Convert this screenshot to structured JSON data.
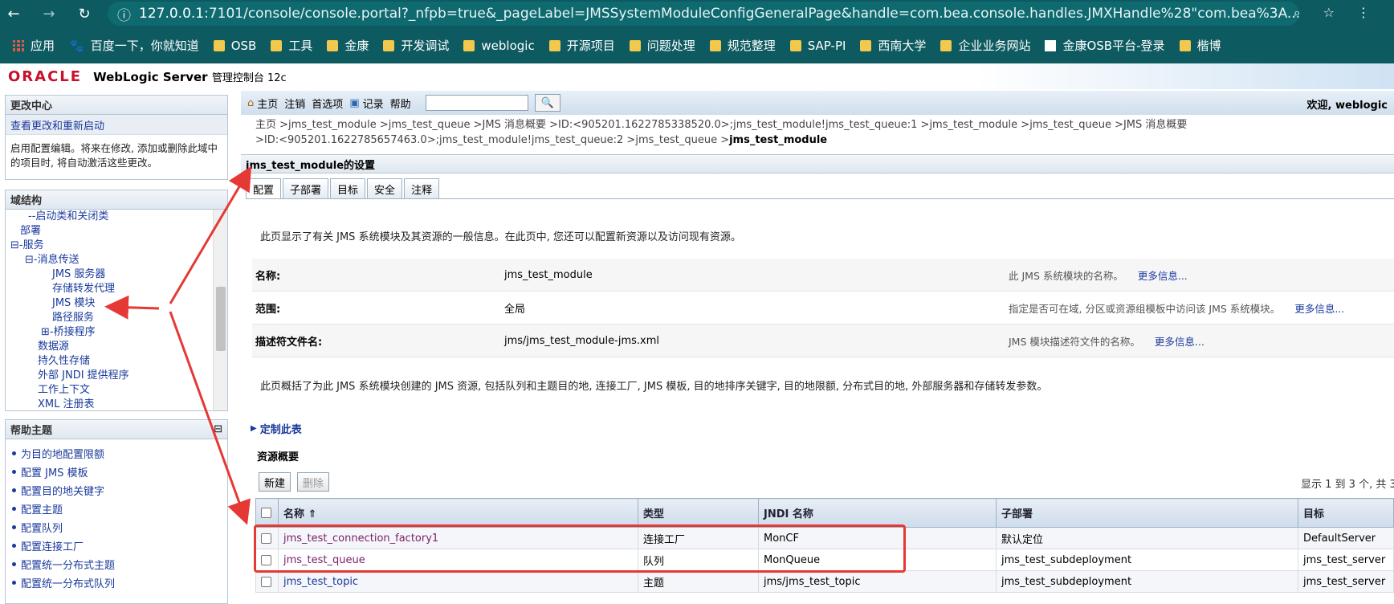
{
  "browser": {
    "url_host": "127.0.0.1",
    "url_rest": ":7101/console/console.portal?_nfpb=true&_pageLabel=JMSSystemModuleConfigGeneralPage&handle=com.bea.console.handles.JMXHandle%28\"com.bea%3A...",
    "bookmarks": [
      "应用",
      "百度一下，你就知道",
      "OSB",
      "工具",
      "金康",
      "开发调试",
      "weblogic",
      "开源项目",
      "问题处理",
      "规范整理",
      "SAP-PI",
      "西南大学",
      "企业业务网站",
      "金康OSB平台-登录",
      "楷博"
    ]
  },
  "header": {
    "logo": "ORACLE",
    "product": "WebLogic Server",
    "product_sub": "管理控制台 12c"
  },
  "change_center": {
    "title": "更改中心",
    "link": "查看更改和重新启动",
    "text": "启用配置编辑。将来在修改, 添加或删除此域中的项目时, 将自动激活这些更改。"
  },
  "domain_tree": {
    "title": "域结构",
    "items": [
      {
        "label": "--启动类和关闭类"
      },
      {
        "label": "部署"
      },
      {
        "label": "⊟-服务"
      },
      {
        "label": "⊟-消息传送"
      },
      {
        "label": "JMS 服务器"
      },
      {
        "label": "存储转发代理"
      },
      {
        "label": "JMS 模块"
      },
      {
        "label": "路径服务"
      },
      {
        "label": "⊞-桥接程序"
      },
      {
        "label": "数据源"
      },
      {
        "label": "持久性存储"
      },
      {
        "label": "外部 JNDI 提供程序"
      },
      {
        "label": "工作上下文"
      },
      {
        "label": "XML 注册表"
      }
    ]
  },
  "help_topics": {
    "title": "帮助主题",
    "items": [
      "为目的地配置限额",
      "配置 JMS 模板",
      "配置目的地关键字",
      "配置主题",
      "配置队列",
      "配置连接工厂",
      "配置统一分布式主题",
      "配置统一分布式队列"
    ]
  },
  "toolbar": {
    "home": "主页",
    "logout": "注销",
    "prefs": "首选项",
    "record": "记录",
    "help": "帮助",
    "welcome": "欢迎, weblogic"
  },
  "breadcrumb": {
    "path": "主页 >jms_test_module >jms_test_queue >JMS 消息概要 >ID:<905201.1622785338520.0>;jms_test_module!jms_test_queue:1 >jms_test_module >jms_test_queue >JMS 消息概要 >ID:<905201.1622785657463.0>;jms_test_module!jms_test_queue:2 >jms_test_queue >",
    "current": "jms_test_module"
  },
  "settings": {
    "title": "jms_test_module的设置",
    "tabs": [
      "配置",
      "子部署",
      "目标",
      "安全",
      "注释"
    ],
    "intro": "此页显示了有关 JMS 系统模块及其资源的一般信息。在此页中, 您还可以配置新资源以及访问现有资源。",
    "props": [
      {
        "label": "名称:",
        "value": "jms_test_module",
        "help": "此 JMS 系统模块的名称。",
        "more": "更多信息..."
      },
      {
        "label": "范围:",
        "value": "全局",
        "help": "指定是否可在域, 分区或资源组模板中访问该 JMS 系统模块。",
        "more": "更多信息..."
      },
      {
        "label": "描述符文件名:",
        "value": "jms/jms_test_module-jms.xml",
        "help": "JMS 模块描述符文件的名称。",
        "more": "更多信息..."
      }
    ],
    "summary": "此页概括了为此 JMS 系统模块创建的 JMS 资源, 包括队列和主题目的地, 连接工厂, JMS 模板, 目的地排序关键字, 目的地限额, 分布式目的地, 外部服务器和存储转发参数。",
    "customize": "定制此表"
  },
  "resources": {
    "title": "资源概要",
    "new_button": "新建",
    "delete_button": "删除",
    "showing": "显示 1 到 3 个, 共 3",
    "columns": [
      "名称 ⇑",
      "类型",
      "JNDI 名称",
      "子部署",
      "目标"
    ],
    "rows": [
      {
        "name": "jms_test_connection_factory1",
        "type": "连接工厂",
        "jndi": "MonCF",
        "sub": "默认定位",
        "target": "DefaultServer"
      },
      {
        "name": "jms_test_queue",
        "type": "队列",
        "jndi": "MonQueue",
        "sub": "jms_test_subdeployment",
        "target": "jms_test_server"
      },
      {
        "name": "jms_test_topic",
        "type": "主题",
        "jndi": "jms/jms_test_topic",
        "sub": "jms_test_subdeployment",
        "target": "jms_test_server"
      }
    ]
  },
  "colors": {
    "browser_bar": "#0d5a60",
    "oracle_red": "#c8102e",
    "annotation_red": "#e53935",
    "link_blue": "#1a3a9c"
  }
}
